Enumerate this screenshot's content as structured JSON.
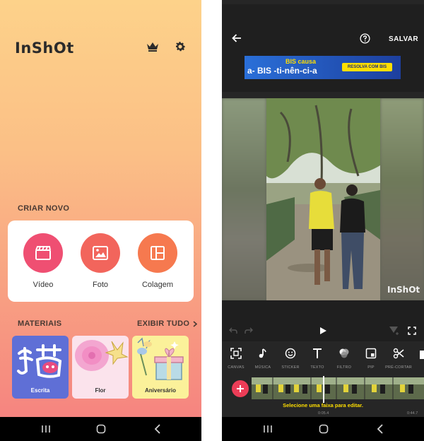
{
  "left": {
    "logo": "InShOt",
    "icons": {
      "premium": "crown-icon",
      "settings": "gear-icon"
    },
    "create_section": {
      "title": "CRIAR NOVO",
      "items": [
        {
          "label": "Vídeo",
          "icon": "clapperboard-icon",
          "color": "#ef4f72"
        },
        {
          "label": "Foto",
          "icon": "image-icon",
          "color": "#f2655c"
        },
        {
          "label": "Colagem",
          "icon": "collage-icon",
          "color": "#f6794f"
        }
      ]
    },
    "materials": {
      "title": "MATERIAIS",
      "view_all": "EXIBIR TUDO",
      "items": [
        {
          "label": "Escrita",
          "color": "#5f6fd6"
        },
        {
          "label": "Flor",
          "color": "#fbe3ec"
        },
        {
          "label": "Aniversário",
          "color": "#fbf19a"
        }
      ]
    }
  },
  "right": {
    "save_label": "SALVAR",
    "ad": {
      "line1": "BIS causa",
      "line2": "a- BIS -ti-nên-ci-a",
      "button": "RESOLVA COM BIS"
    },
    "watermark": "InShOt",
    "tools": [
      {
        "label": "CANVAS",
        "icon": "canvas-icon"
      },
      {
        "label": "MÚSICA",
        "icon": "music-icon"
      },
      {
        "label": "STICKER",
        "icon": "sticker-icon"
      },
      {
        "label": "TEXTO",
        "icon": "text-icon"
      },
      {
        "label": "FILTRO",
        "icon": "filter-icon"
      },
      {
        "label": "PIP",
        "icon": "pip-icon"
      },
      {
        "label": "PRÉ-CORTAR",
        "icon": "scissors-icon"
      }
    ],
    "timeline": {
      "hint": "Selecione uma faixa para editar.",
      "current_time": "0:05.4",
      "total_time": "0:44.7"
    },
    "accent": "#ffde00"
  }
}
